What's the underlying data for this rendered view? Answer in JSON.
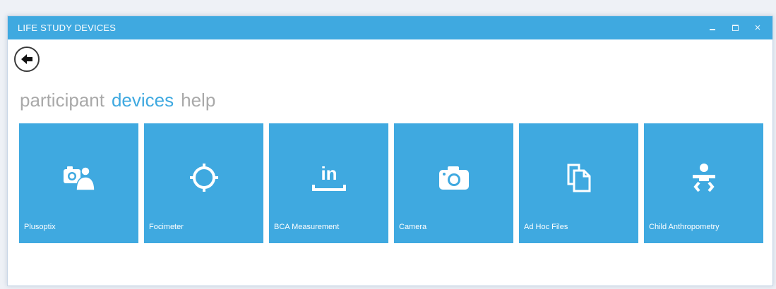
{
  "window": {
    "title": "LIFE STUDY DEVICES",
    "accent_color": "#3fa9e0"
  },
  "back_button": {
    "icon": "arrow-left-icon"
  },
  "tabs": [
    {
      "label": "participant",
      "active": false
    },
    {
      "label": "devices",
      "active": true
    },
    {
      "label": "help",
      "active": false
    }
  ],
  "tiles": [
    {
      "label": "Plusoptix",
      "icon": "photo-person-icon"
    },
    {
      "label": "Focimeter",
      "icon": "crosshair-icon"
    },
    {
      "label": "BCA Measurement",
      "icon": "inch-ruler-icon"
    },
    {
      "label": "Camera",
      "icon": "camera-icon"
    },
    {
      "label": "Ad Hoc Files",
      "icon": "documents-icon"
    },
    {
      "label": "Child Anthropometry",
      "icon": "baby-icon"
    }
  ]
}
